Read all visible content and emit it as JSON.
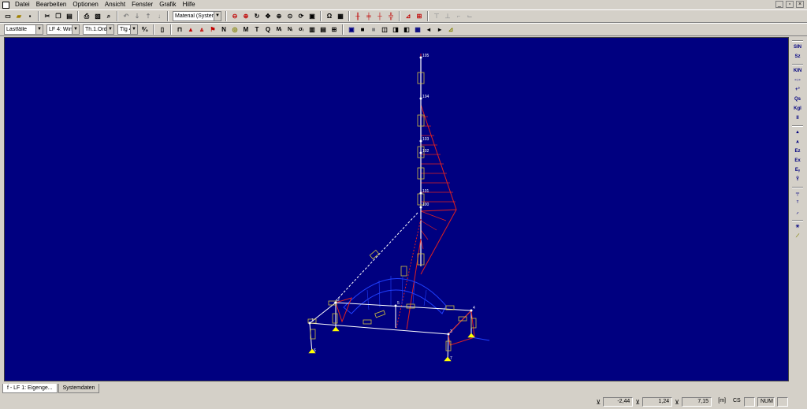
{
  "menu": [
    "Datei",
    "Bearbeiten",
    "Optionen",
    "Ansicht",
    "Fenster",
    "Grafik",
    "Hilfe"
  ],
  "toolbar1": {
    "material_combo": "Material   (System)"
  },
  "toolbar2": {
    "combo_lastfaelle": "Lastfälle",
    "combo_lf": "LF 4: Wind +",
    "combo_theorie": "Th.1.Ord",
    "combo_tlg": "Tlg 4",
    "letters": [
      "N",
      "O",
      "M",
      "T",
      "Q",
      "M",
      "N"
    ]
  },
  "right_panel": [
    "SIN",
    "Sz",
    "KIN",
    "Qs",
    "Kgl",
    "II",
    "Ez",
    "Ex"
  ],
  "nodes": [
    "105",
    "104",
    "103",
    "102",
    "101",
    "100",
    "1",
    "2",
    "3",
    "4",
    "5",
    "6",
    "7"
  ],
  "tabs": [
    "f - LF 1: Eigenge...",
    "Systemdaten"
  ],
  "status": {
    "x": "-2,44",
    "y": "1,24",
    "z": "7,15",
    "unit": "[m]",
    "cs": "CS",
    "num": "NUM"
  },
  "colors": {
    "canvas_bg": "#000080",
    "structure": "#ffffff",
    "load_diagram": "#e02020",
    "load_diagram_blue": "#2040ff",
    "supports": "#ffff00",
    "node_labels": "#ffffff"
  }
}
